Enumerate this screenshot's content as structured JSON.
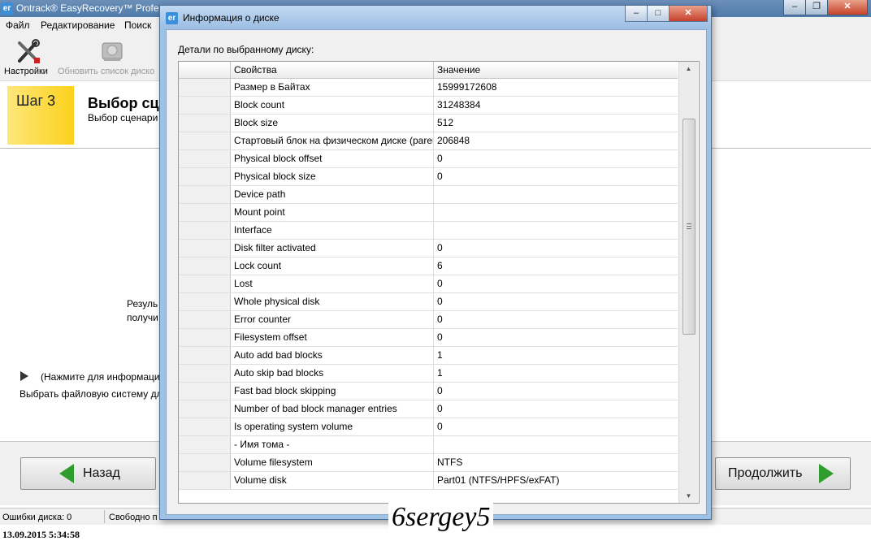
{
  "main_window": {
    "title": "Ontrack® EasyRecovery™ Profes",
    "app_icon": "er",
    "menu": [
      "Файл",
      "Редактирование",
      "Поиск"
    ],
    "toolbar": {
      "settings_label": "Настройки",
      "refresh_label": "Обновить список диско"
    },
    "step": {
      "number": "Шаг 3",
      "title": "Выбор сц",
      "subtitle": "Выбор сценари"
    },
    "content": {
      "result_line1": "Резуль",
      "result_line2": "получи",
      "info_hint": "(Нажмите для информаци",
      "fs_choice": "Выбрать файловую систему дл"
    },
    "buttons": {
      "back": "Назад",
      "continue": "Продолжить"
    },
    "status": {
      "disk_errors": "Ошибки диска: 0",
      "free": "Свободно п"
    },
    "window_buttons": {
      "minimize": "–",
      "maximize": "❐",
      "close": "✕"
    }
  },
  "dialog": {
    "title": "Информация о диске",
    "icon": "er",
    "caption": "Детали по выбранному диску:",
    "columns": {
      "property": "Свойства",
      "value": "Значение"
    },
    "rows": [
      {
        "property": "Размер в Байтах",
        "value": "15999172608"
      },
      {
        "property": "Block count",
        "value": "31248384"
      },
      {
        "property": "Block size",
        "value": "512"
      },
      {
        "property": "Стартовый блок на физическом диске (parent",
        "value": "206848"
      },
      {
        "property": "Physical block offset",
        "value": "0"
      },
      {
        "property": "Physical block size",
        "value": "0"
      },
      {
        "property": "Device path",
        "value": ""
      },
      {
        "property": "Mount point",
        "value": ""
      },
      {
        "property": "Interface",
        "value": ""
      },
      {
        "property": "Disk filter activated",
        "value": "0"
      },
      {
        "property": "Lock count",
        "value": "6"
      },
      {
        "property": "Lost",
        "value": "0"
      },
      {
        "property": "Whole physical disk",
        "value": "0"
      },
      {
        "property": "Error counter",
        "value": "0"
      },
      {
        "property": "Filesystem offset",
        "value": "0"
      },
      {
        "property": "Auto add bad blocks",
        "value": "1"
      },
      {
        "property": "Auto skip bad blocks",
        "value": "1"
      },
      {
        "property": "Fast bad block skipping",
        "value": "0"
      },
      {
        "property": "Number of bad block manager entries",
        "value": "0"
      },
      {
        "property": "Is operating system volume",
        "value": "0"
      },
      {
        "property": "- Имя тома -",
        "value": ""
      },
      {
        "property": "Volume filesystem",
        "value": "NTFS"
      },
      {
        "property": "Volume disk",
        "value": "Part01 (NTFS/HPFS/exFAT)"
      }
    ],
    "window_buttons": {
      "minimize": "–",
      "maximize": "□",
      "close": "✕"
    }
  },
  "timestamp": "13.09.2015 5:34:58",
  "watermark": "6sergey5"
}
